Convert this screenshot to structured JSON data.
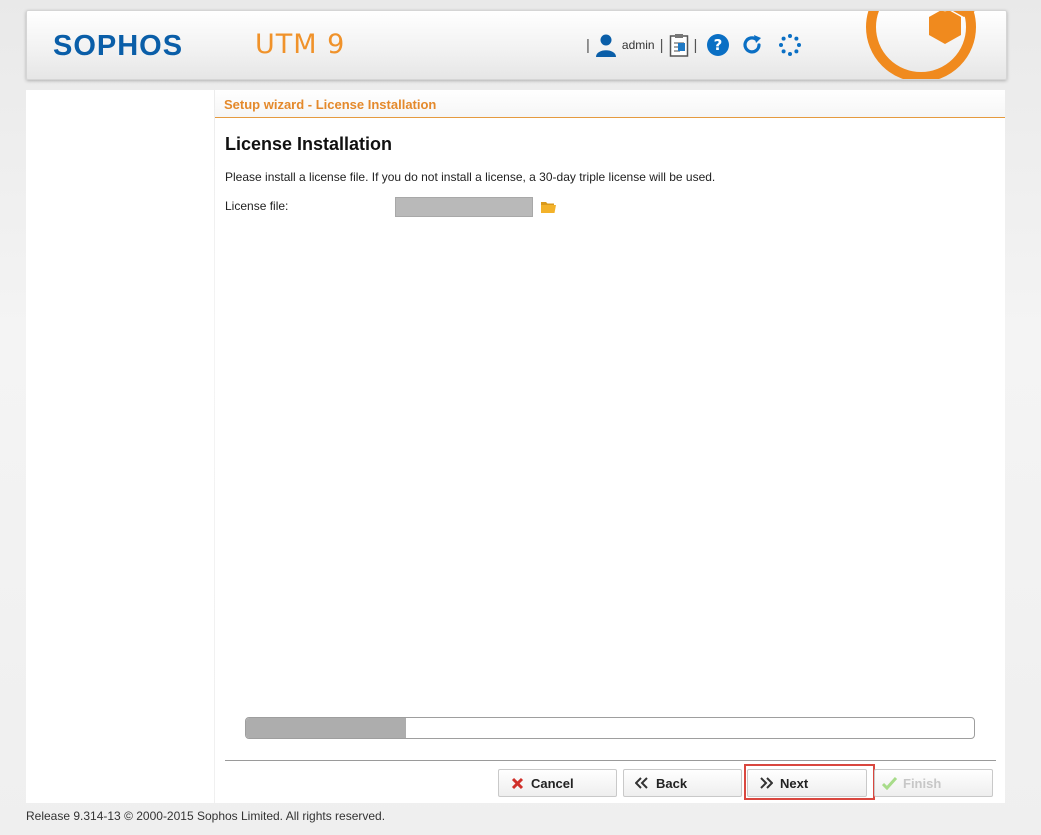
{
  "header": {
    "logo": "SOPHOS",
    "product": "UTM 9",
    "user": "admin",
    "separator": "|"
  },
  "wizard": {
    "title": "Setup wizard - License Installation",
    "heading": "License Installation",
    "description": "Please install a license file. If you do not install a license, a 30-day triple license will be used.",
    "license_label": "License file:",
    "license_value": "",
    "progress_percent": 22
  },
  "buttons": {
    "cancel": "Cancel",
    "back": "Back",
    "next": "Next",
    "finish": "Finish"
  },
  "footer": "Release 9.314-13  © 2000-2015 Sophos Limited. All rights reserved.",
  "colors": {
    "brand_blue": "#0a5ea8",
    "accent_orange": "#e4892b",
    "highlight_red": "#d9473f"
  },
  "icons": [
    "user-icon",
    "clipboard-icon",
    "help-icon",
    "refresh-icon",
    "spinner-icon",
    "folder-icon",
    "cancel-x-icon",
    "back-chevron-icon",
    "next-chevron-icon",
    "finish-check-icon"
  ]
}
